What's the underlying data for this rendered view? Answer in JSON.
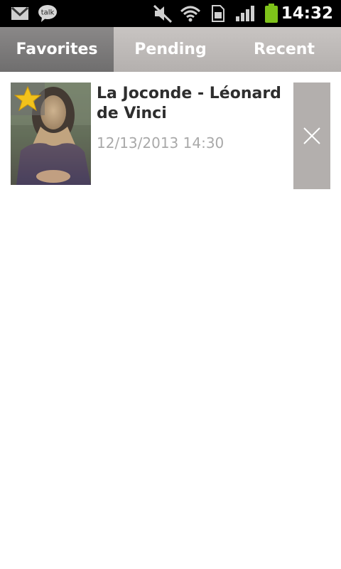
{
  "status_bar": {
    "time": "14:32",
    "icons": [
      "gmail-icon",
      "talk-icon",
      "muted-icon",
      "wifi-icon",
      "sim-card-icon",
      "signal-icon",
      "battery-icon"
    ],
    "talk_label": "talk",
    "battery_color": "#7ec21a"
  },
  "tabs": [
    {
      "label": "Favorites",
      "active": true
    },
    {
      "label": "Pending",
      "active": false
    },
    {
      "label": "Recent",
      "active": false
    }
  ],
  "list": {
    "items": [
      {
        "title": "La Joconde - Léonard de Vinci",
        "date": "12/13/2013 14:30",
        "favorite": true,
        "thumbnail_icon": "mona-lisa-thumbnail",
        "delete_icon": "close-icon"
      }
    ]
  },
  "colors": {
    "status_bg": "#000000",
    "tab_active_bg": "#7a7979",
    "tab_inactive_bg": "#bfbbb9",
    "star": "#f2c21b",
    "delete_bg": "#b3afad"
  }
}
